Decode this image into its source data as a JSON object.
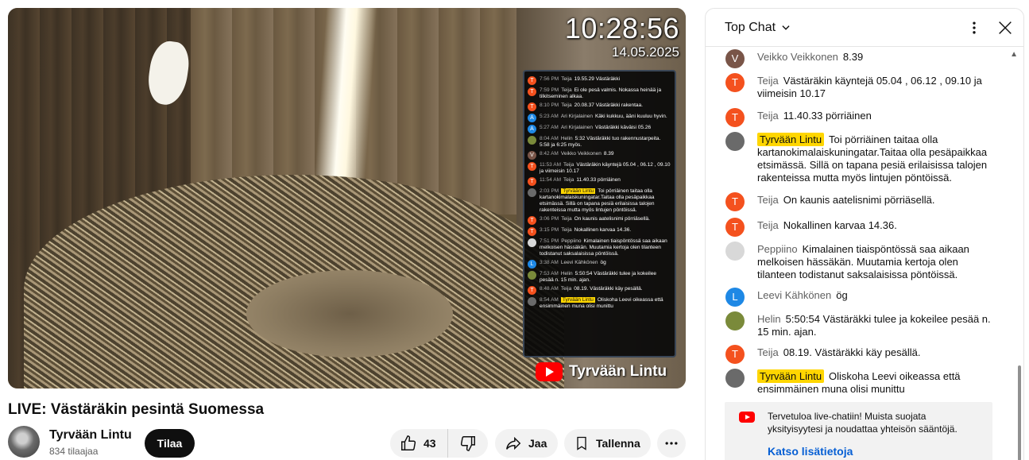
{
  "video": {
    "clock_time": "10:28:56",
    "clock_date": "14.05.2025",
    "brand": "Tyrvään Lintu",
    "overlay_chat": [
      {
        "initial": "T",
        "color": "#f4511e",
        "time": "7:56 PM",
        "name": "Teija",
        "badge": false,
        "text": "19.55.29 Västäräkki"
      },
      {
        "initial": "T",
        "color": "#f4511e",
        "time": "7:59 PM",
        "name": "Teija",
        "badge": false,
        "text": "Ei ole pesä valmis. Nokassa heinää ja tilkitseminen alkaa."
      },
      {
        "initial": "T",
        "color": "#f4511e",
        "time": "8:10 PM",
        "name": "Teija",
        "badge": false,
        "text": "20.08.37 Västäräkki rakentaa."
      },
      {
        "initial": "A",
        "color": "#1e88e5",
        "time": "5:23 AM",
        "name": "Ari Kirjalainen",
        "badge": false,
        "text": "Käki kukkuu, ääni kuuluu hyvin."
      },
      {
        "initial": "A",
        "color": "#1e88e5",
        "time": "5:27 AM",
        "name": "Ari Kirjalainen",
        "badge": false,
        "text": "Västäräkki käväisi 05.26"
      },
      {
        "initial": "",
        "color": "#7a8a3a",
        "time": "8:04 AM",
        "name": "Helin",
        "badge": false,
        "text": "5:32 Västäräkki tuo rakennustarpeita. 5:58 ja 6:25 myös."
      },
      {
        "initial": "V",
        "color": "#795548",
        "time": "8:42 AM",
        "name": "Veikko Veikkonen",
        "badge": false,
        "text": "8.39"
      },
      {
        "initial": "T",
        "color": "#f4511e",
        "time": "11:53 AM",
        "name": "Teija",
        "badge": false,
        "text": "Västäräkin käyntejä 05.04 , 06.12 , 09.10 ja viimeisin 10.17"
      },
      {
        "initial": "T",
        "color": "#f4511e",
        "time": "11:54 AM",
        "name": "Teija",
        "badge": false,
        "text": "11.40.33 pörriäinen"
      },
      {
        "initial": "",
        "color": "#6a6a6a",
        "time": "2:03 PM",
        "name": "Tyrvään Lintu",
        "badge": true,
        "text": "Toi pörriäinen taitaa olla kartanokimalaiskuningatar.Taitaa olla pesäpaikkaa etsimässä. Sillä on tapana pesiä erilaisissa talojen rakenteissa mutta myös lintujen pöntöissä."
      },
      {
        "initial": "T",
        "color": "#f4511e",
        "time": "3:06 PM",
        "name": "Teija",
        "badge": false,
        "text": "On kaunis aatelisnimi pörriäsellä."
      },
      {
        "initial": "T",
        "color": "#f4511e",
        "time": "3:15 PM",
        "name": "Teija",
        "badge": false,
        "text": "Nokallinen karvaa 14.36."
      },
      {
        "initial": "",
        "color": "#d8d8d8",
        "time": "7:51 PM",
        "name": "Peppiino",
        "badge": false,
        "text": "Kimalainen tiaispöntössä saa aikaan melkoisen hässäkän. Muutamia kertoja olen tilanteen todistanut saksalaisissa pöntöissä."
      },
      {
        "initial": "L",
        "color": "#1e88e5",
        "time": "3:38 AM",
        "name": "Leevi Kähkönen",
        "badge": false,
        "text": "ög"
      },
      {
        "initial": "",
        "color": "#7a8a3a",
        "time": "7:53 AM",
        "name": "Helin",
        "badge": false,
        "text": "5:50:54 Västäräkki tulee ja kokeilee pesää n. 15 min. ajan."
      },
      {
        "initial": "T",
        "color": "#f4511e",
        "time": "8:48 AM",
        "name": "Teija",
        "badge": false,
        "text": "08.19. Västäräkki käy pesällä."
      },
      {
        "initial": "",
        "color": "#6a6a6a",
        "time": "8:54 AM",
        "name": "Tyrvään Lintu",
        "badge": true,
        "text": "Oliskoha Leevi oikeassa että ensimmäinen muna olisi munittu"
      }
    ]
  },
  "title": "LIVE: Västäräkin pesintä Suomessa",
  "channel": {
    "name": "Tyrvään Lintu",
    "subscribers": "834 tilaajaa",
    "subscribe_label": "Tilaa"
  },
  "actions": {
    "like_count": "43",
    "share_label": "Jaa",
    "save_label": "Tallenna"
  },
  "chat": {
    "title": "Top Chat",
    "messages": [
      {
        "initial": "V",
        "color": "#795548",
        "author": "Veikko Veikkonen",
        "badge": false,
        "text": "8.39"
      },
      {
        "initial": "T",
        "color": "#f4511e",
        "author": "Teija",
        "badge": false,
        "text": "Västäräkin käyntejä 05.04 , 06.12 , 09.10 ja viimeisin 10.17"
      },
      {
        "initial": "T",
        "color": "#f4511e",
        "author": "Teija",
        "badge": false,
        "text": "11.40.33 pörriäinen"
      },
      {
        "initial": "",
        "color": "#6a6a6a",
        "author": "Tyrvään Lintu",
        "badge": true,
        "text": "Toi pörriäinen taitaa olla kartanokimalaiskuningatar.Taitaa olla pesäpaikkaa etsimässä. Sillä on tapana pesiä erilaisissa talojen rakenteissa mutta myös lintujen pöntöissä."
      },
      {
        "initial": "T",
        "color": "#f4511e",
        "author": "Teija",
        "badge": false,
        "text": "On kaunis aatelisnimi pörriäsellä."
      },
      {
        "initial": "T",
        "color": "#f4511e",
        "author": "Teija",
        "badge": false,
        "text": "Nokallinen karvaa 14.36."
      },
      {
        "initial": "",
        "color": "#d8d8d8",
        "author": "Peppiino",
        "badge": false,
        "text": "Kimalainen tiaispöntössä saa aikaan melkoisen hässäkän. Muutamia kertoja olen tilanteen todistanut saksalaisissa pöntöissä."
      },
      {
        "initial": "L",
        "color": "#1e88e5",
        "author": "Leevi Kähkönen",
        "badge": false,
        "text": "ög"
      },
      {
        "initial": "",
        "color": "#7a8a3a",
        "author": "Helin",
        "badge": false,
        "text": "5:50:54 Västäräkki tulee ja kokeilee pesää n. 15 min. ajan."
      },
      {
        "initial": "T",
        "color": "#f4511e",
        "author": "Teija",
        "badge": false,
        "text": "08.19. Västäräkki käy pesällä."
      },
      {
        "initial": "",
        "color": "#6a6a6a",
        "author": "Tyrvään Lintu",
        "badge": true,
        "text": "Oliskoha Leevi oikeassa että ensimmäinen muna olisi munittu"
      }
    ],
    "banner_text": "Tervetuloa live-chatiin! Muista suojata yksityisyytesi ja noudattaa yhteisön sääntöjä.",
    "banner_link": "Katso lisätietoja"
  }
}
